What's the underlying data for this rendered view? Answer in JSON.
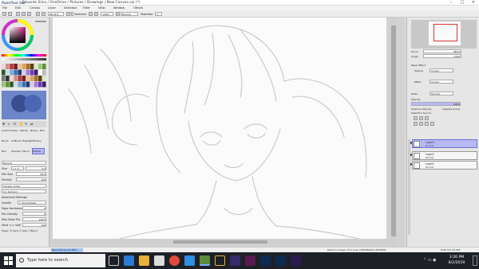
{
  "window": {
    "app_name": "PaintTool SAI",
    "title": "Eduardo Silva / OneDrive / Pictures / Drawings / New Canvas.sai (*)"
  },
  "menu": [
    "File",
    "Edit",
    "Canvas",
    "Layer",
    "Selection",
    "Filter",
    "View",
    "Window",
    "Others"
  ],
  "toolbar": {
    "zoom": "88.02%",
    "selection_label": "Selection",
    "angle": "+000°",
    "blend_mode": "Normal",
    "stabilizer_label": "Stabilizer",
    "stabilizer_value": "3"
  },
  "left_panel": {
    "tool_tabs": [
      "Custom",
      "Erase",
      "Marker",
      "Binary",
      "Blur"
    ],
    "tool_row1": [
      "Brush",
      "AirBrush",
      "Highlight",
      "Binary"
    ],
    "tool_row2": [
      "Blur",
      "Sharpen",
      "Pencil",
      "Marker"
    ],
    "blend": "Normal",
    "size_label": "Size",
    "size_value": "x 1.0",
    "size_num": "4.0",
    "min_size_label": "Min Size",
    "min_size_value": "50%",
    "density_label": "Density",
    "density_value": "100",
    "shape": "[simple circle]",
    "texture": "[no texture]",
    "advanced_label": "Advanced Settings",
    "quality_label": "Quality",
    "quality_value": "1 (Smoothest)",
    "edge_hardness_label": "Edge Hardness",
    "edge_hardness_value": "0",
    "min_density_label": "Min Density",
    "min_density_value": "0",
    "max_dens_prs_label": "Max Dens Prs.",
    "max_dens_prs_value": "100%",
    "hard_soft_label": "Hard <-> Soft",
    "hard_soft_value": "100",
    "press_label": "Press: ☑ Dens ☑ Size ☐ Blend"
  },
  "right_panel": {
    "zoom_label": "Zoom",
    "zoom_value": "88.0%",
    "angle_label": "Angle",
    "angle_value": "+000°",
    "paper_effect_label": "Paper Effect",
    "texture_label": "Texture",
    "texture_value": "[none]",
    "effect_label": "Effect",
    "effect_value": "[none]",
    "mode_label": "Mode",
    "mode_value": "Normal",
    "opacity_label": "Opacity",
    "opacity_value": "100%",
    "preserve_opacity": "Preserve Opacity",
    "clipping_group": "Clipping Group",
    "selection_source": "Selection Source",
    "layers": [
      {
        "name": "Layer3",
        "mode": "Normal",
        "opacity": "100%",
        "selected": true
      },
      {
        "name": "Layer2",
        "mode": "Normal",
        "opacity": "100%",
        "selected": false
      },
      {
        "name": "Layer1",
        "mode": "Normal",
        "opacity": "100%",
        "selected": false
      }
    ]
  },
  "status": {
    "doc_tab": "New Canvas.sai",
    "doc_zoom": "88%",
    "memory": "Memory Usage: 31% (Use 2294MB/Max 8096MB)",
    "keys": "Shift Ctrl Alt SPC"
  },
  "taskbar": {
    "search_placeholder": "Type here to search",
    "time": "3:26 PM",
    "date": "8/2/2019"
  },
  "colors": {
    "accent": "#6b6fd8",
    "selected_layer": "#b7b9f5",
    "taskbar": "#1d2127",
    "swatch_primary": "#3a4f8f",
    "swatch_secondary": "#4a66b4"
  }
}
